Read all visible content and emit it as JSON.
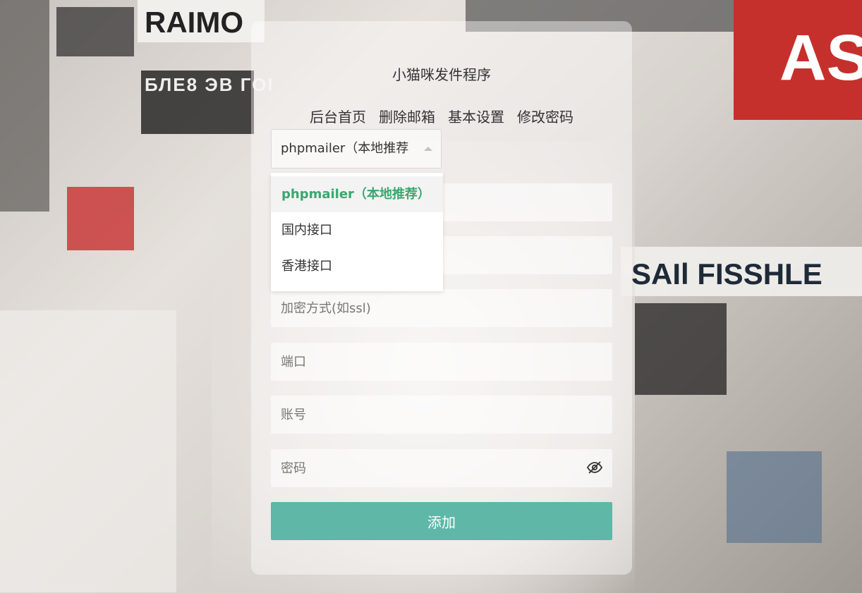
{
  "background": {
    "texts": [
      "RAIMO",
      "БЛЕ8 ЭВ ГОІ",
      "AS",
      "SAIl FISSHLE"
    ]
  },
  "app": {
    "title": "小猫咪发件程序"
  },
  "nav": {
    "items": [
      {
        "label": "后台首页"
      },
      {
        "label": "删除邮箱"
      },
      {
        "label": "基本设置"
      },
      {
        "label": "修改密码"
      }
    ]
  },
  "form": {
    "select": {
      "value": "phpmailer（本地推荐",
      "options": [
        {
          "label": "phpmailer（本地推荐）",
          "selected": true
        },
        {
          "label": "国内接口",
          "selected": false
        },
        {
          "label": "香港接口",
          "selected": false
        }
      ]
    },
    "fields": {
      "encryption_placeholder": "加密方式(如ssl)",
      "port_placeholder": "端口",
      "account_placeholder": "账号",
      "password_placeholder": "密码"
    },
    "submit_label": "添加"
  },
  "colors": {
    "accent": "#5fb8a7",
    "selected_option": "#3aa76d"
  },
  "icons": {
    "password_toggle": "eye-slash-icon"
  }
}
